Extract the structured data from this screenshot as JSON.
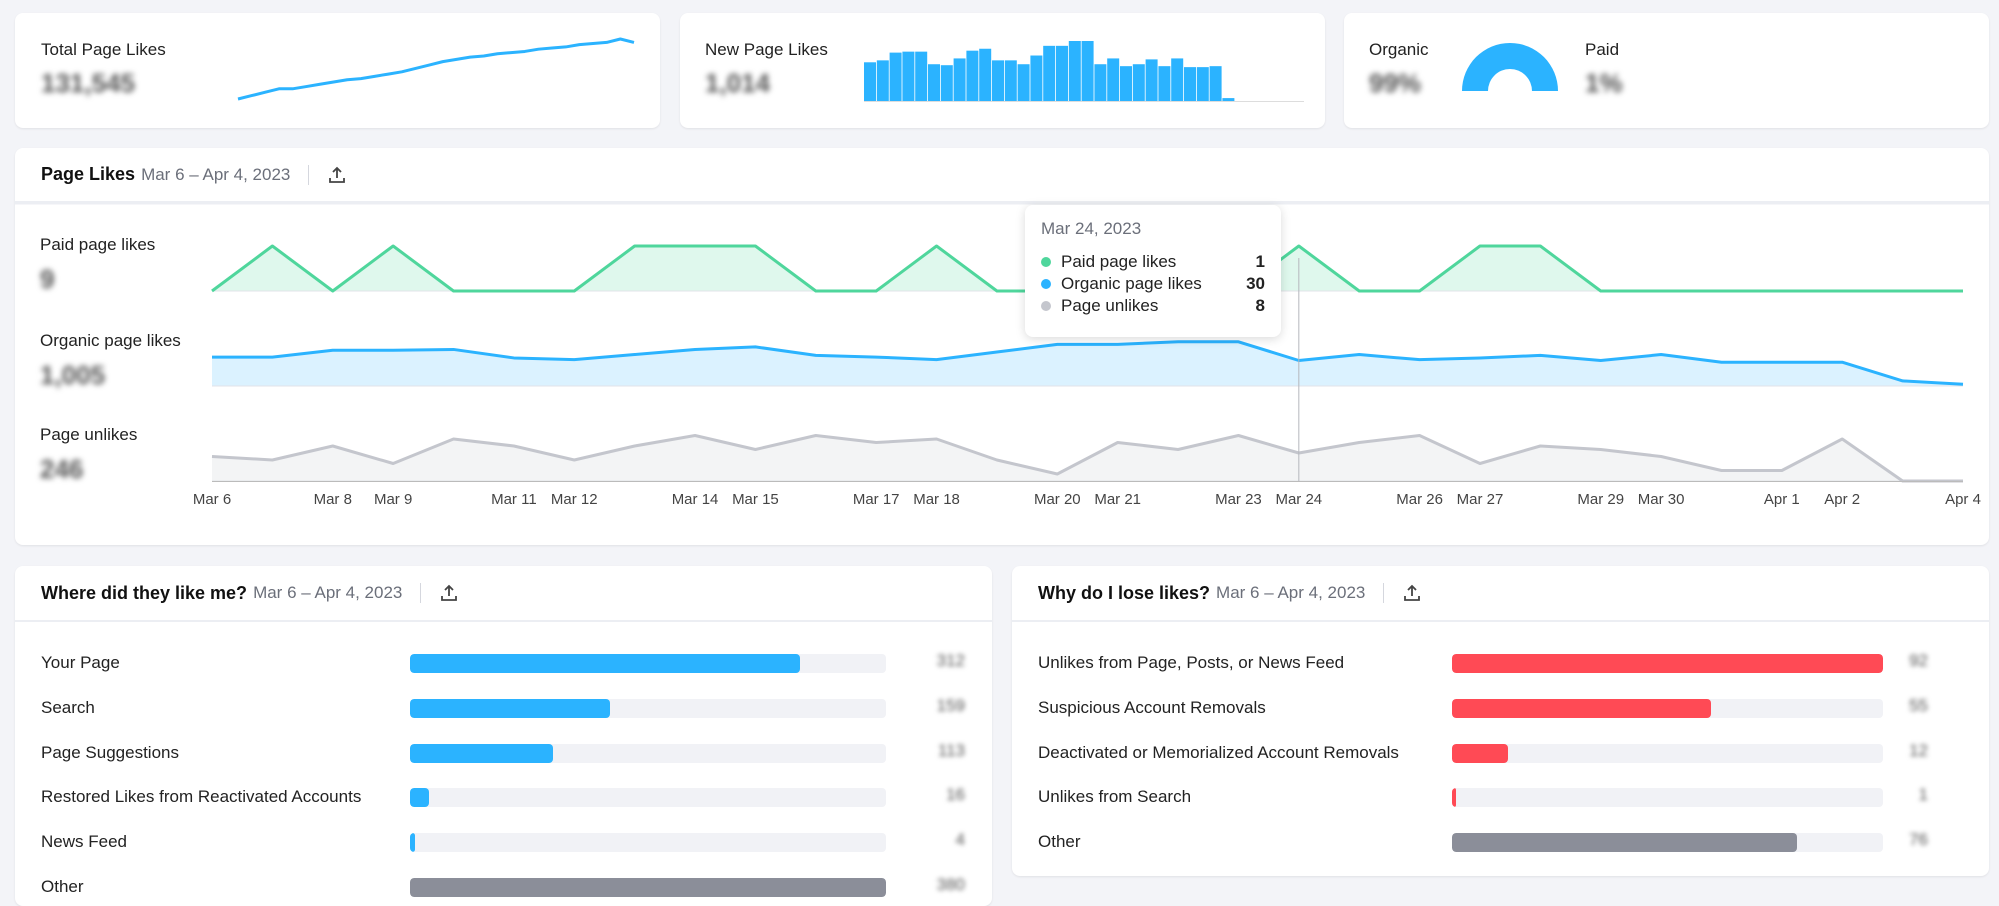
{
  "summary": {
    "total": {
      "label": "Total Page Likes",
      "value": "131,545",
      "trend": [
        0,
        3,
        6,
        9,
        9,
        11,
        13,
        15,
        17,
        18,
        20,
        22,
        24,
        27,
        30,
        33,
        35,
        37,
        38,
        40,
        41,
        42,
        44,
        45,
        46,
        48,
        49,
        50,
        53,
        50
      ]
    },
    "new": {
      "label": "New Page Likes",
      "value": "1,014",
      "bars": [
        40,
        42,
        50,
        51,
        51,
        38,
        37,
        44,
        52,
        54,
        42,
        42,
        38,
        47,
        57,
        57,
        62,
        62,
        38,
        44,
        36,
        38,
        43,
        36,
        44,
        35,
        35,
        36,
        3
      ]
    },
    "split": {
      "organic_label": "Organic",
      "organic_value": "99%",
      "paid_label": "Paid",
      "paid_value": "1%",
      "organic_fraction": 0.99
    }
  },
  "page_likes": {
    "title": "Page Likes",
    "date_range": "Mar 6 – Apr 4, 2023",
    "export_icon": "upload-icon",
    "series": [
      {
        "name": "Paid page likes",
        "total": "9",
        "color": "#4fd69c",
        "values": [
          0,
          1,
          0,
          1,
          0,
          0,
          0,
          1,
          1,
          1,
          0,
          0,
          1,
          0,
          0,
          0,
          0,
          0,
          1,
          0,
          0,
          1,
          1,
          0,
          0,
          0,
          0,
          0,
          0,
          0
        ]
      },
      {
        "name": "Organic page likes",
        "total": "1,005",
        "color": "#2bb3ff",
        "values": [
          34,
          34,
          42,
          42,
          43,
          33,
          31,
          37,
          43,
          46,
          36,
          34,
          31,
          40,
          49,
          49,
          52,
          52,
          30,
          37,
          31,
          33,
          36,
          30,
          37,
          28,
          28,
          28,
          6,
          2
        ]
      },
      {
        "name": "Page unlikes",
        "total": "246",
        "color": "#c4c6cd",
        "values": [
          7,
          6,
          10,
          5,
          12,
          10,
          6,
          10,
          13,
          9,
          13,
          11,
          12,
          6,
          2,
          11,
          9,
          13,
          8,
          11,
          13,
          5,
          10,
          9,
          7,
          3,
          3,
          12,
          0,
          0
        ]
      }
    ],
    "x_ticks": [
      {
        "label": "Mar 6",
        "i": 0
      },
      {
        "label": "Mar 8",
        "i": 2
      },
      {
        "label": "Mar 9",
        "i": 3
      },
      {
        "label": "Mar 11",
        "i": 5
      },
      {
        "label": "Mar 12",
        "i": 6
      },
      {
        "label": "Mar 14",
        "i": 8
      },
      {
        "label": "Mar 15",
        "i": 9
      },
      {
        "label": "Mar 17",
        "i": 11
      },
      {
        "label": "Mar 18",
        "i": 12
      },
      {
        "label": "Mar 20",
        "i": 14
      },
      {
        "label": "Mar 21",
        "i": 15
      },
      {
        "label": "Mar 23",
        "i": 17
      },
      {
        "label": "Mar 24",
        "i": 18
      },
      {
        "label": "Mar 26",
        "i": 20
      },
      {
        "label": "Mar 27",
        "i": 21
      },
      {
        "label": "Mar 29",
        "i": 23
      },
      {
        "label": "Mar 30",
        "i": 24
      },
      {
        "label": "Apr 1",
        "i": 26
      },
      {
        "label": "Apr 2",
        "i": 27
      },
      {
        "label": "Apr 4",
        "i": 29
      }
    ],
    "tooltip": {
      "date": "Mar 24, 2023",
      "index": 18,
      "rows": [
        {
          "label": "Paid page likes",
          "value": "1",
          "color": "#4fd69c"
        },
        {
          "label": "Organic page likes",
          "value": "30",
          "color": "#2bb3ff"
        },
        {
          "label": "Page unlikes",
          "value": "8",
          "color": "#c4c6cd"
        }
      ]
    }
  },
  "where": {
    "title": "Where did they like me?",
    "date_range": "Mar 6 – Apr 4, 2023",
    "rows": [
      {
        "label": "Your Page",
        "value": "312",
        "fraction": 0.82,
        "color": "#2bb3ff"
      },
      {
        "label": "Search",
        "value": "159",
        "fraction": 0.42,
        "color": "#2bb3ff"
      },
      {
        "label": "Page Suggestions",
        "value": "113",
        "fraction": 0.3,
        "color": "#2bb3ff"
      },
      {
        "label": "Restored Likes from Reactivated Accounts",
        "value": "16",
        "fraction": 0.04,
        "color": "#2bb3ff"
      },
      {
        "label": "News Feed",
        "value": "4",
        "fraction": 0.01,
        "color": "#2bb3ff"
      },
      {
        "label": "Other",
        "value": "380",
        "fraction": 1.0,
        "color": "#8b8e99"
      }
    ]
  },
  "lose": {
    "title": "Why do I lose likes?",
    "date_range": "Mar 6 – Apr 4, 2023",
    "rows": [
      {
        "label": "Unlikes from Page, Posts, or News Feed",
        "value": "92",
        "fraction": 1.0,
        "color": "#ff4a55"
      },
      {
        "label": "Suspicious Account Removals",
        "value": "55",
        "fraction": 0.6,
        "color": "#ff4a55"
      },
      {
        "label": "Deactivated or Memorialized Account Removals",
        "value": "12",
        "fraction": 0.13,
        "color": "#ff4a55"
      },
      {
        "label": "Unlikes from Search",
        "value": "1",
        "fraction": 0.01,
        "color": "#ff4a55"
      },
      {
        "label": "Other",
        "value": "76",
        "fraction": 0.8,
        "color": "#8b8e99"
      }
    ]
  }
}
